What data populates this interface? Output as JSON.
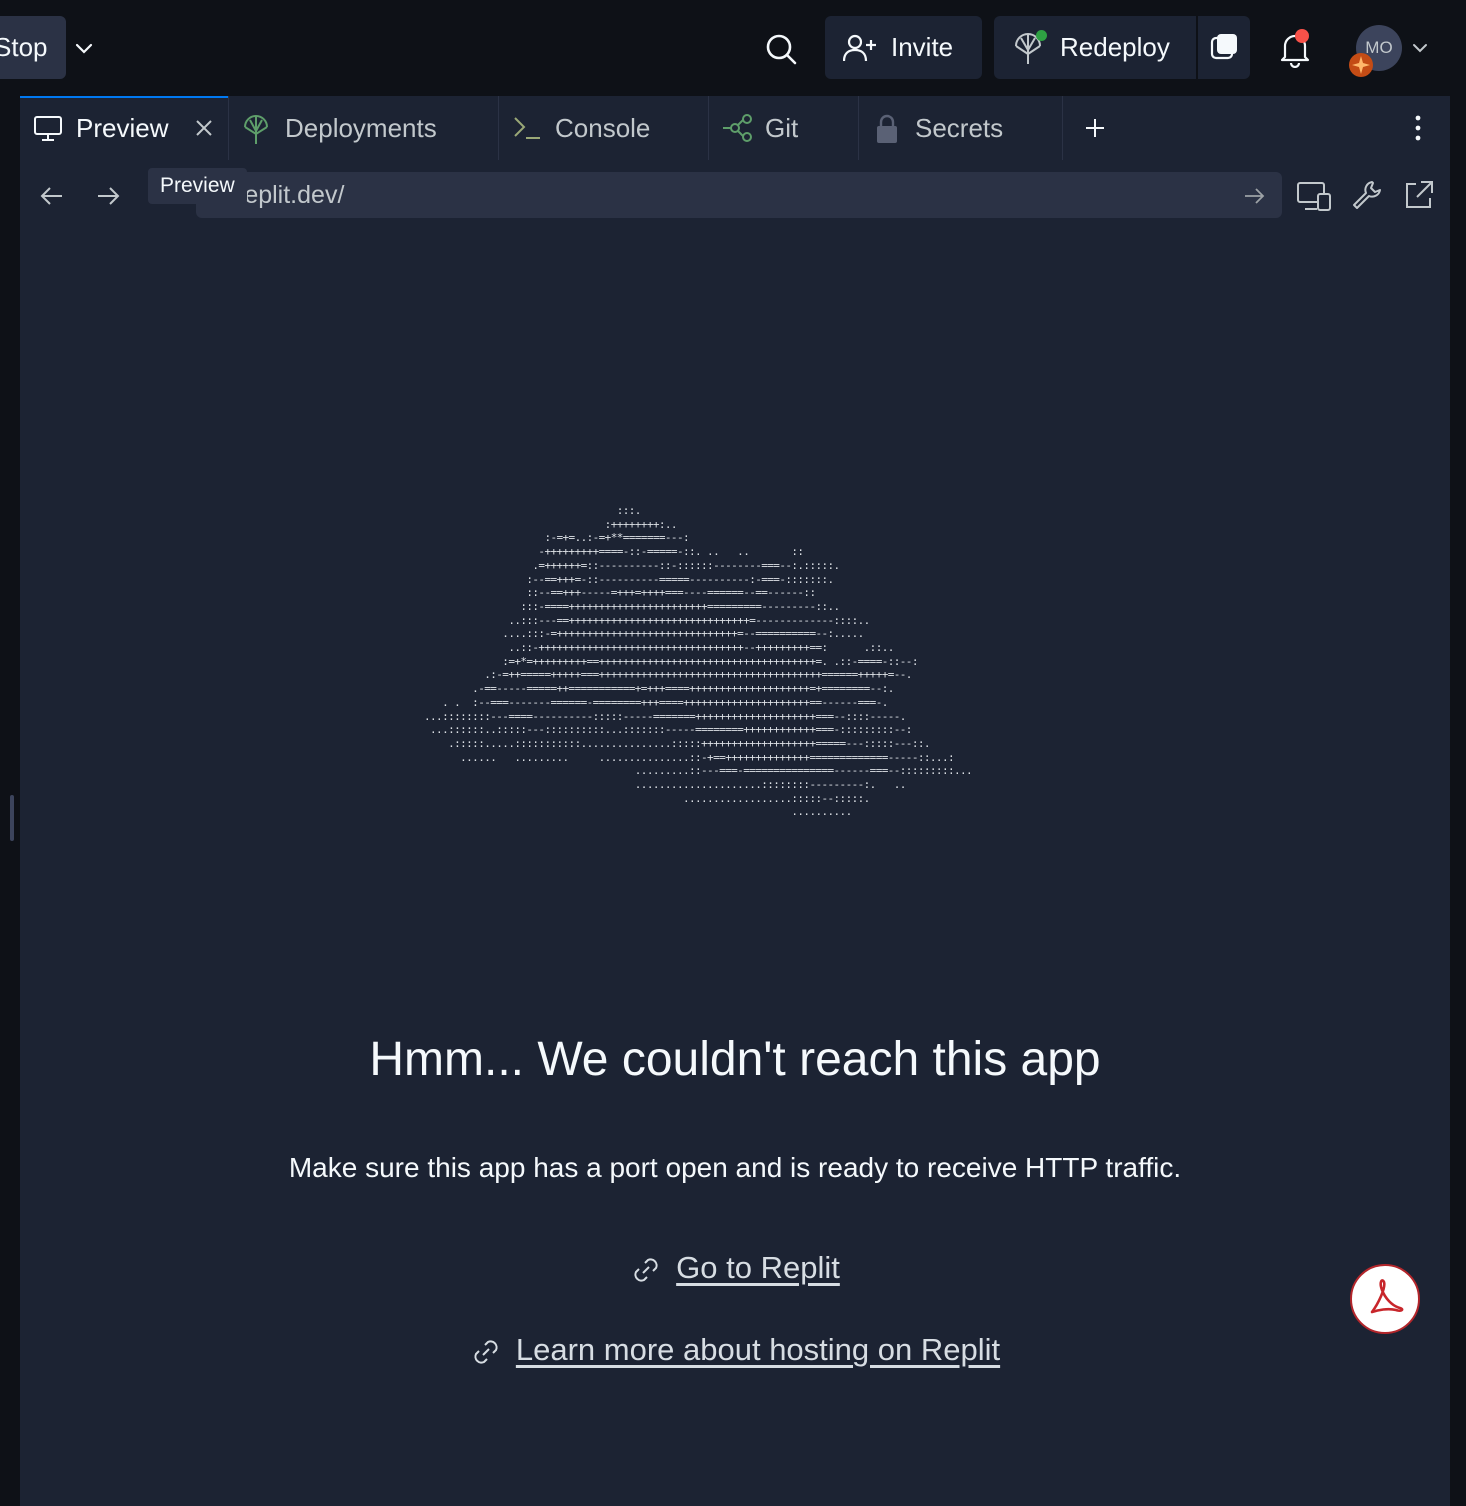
{
  "topbar": {
    "stop_label": "Stop",
    "invite_label": "Invite",
    "redeploy_label": "Redeploy",
    "avatar_initials": "MO",
    "notification_dot_color": "#f85149",
    "deploy_status_color": "#2ea043"
  },
  "tabs": [
    {
      "label": "Preview",
      "icon": "monitor-icon",
      "active": true
    },
    {
      "label": "Deployments",
      "icon": "deploy-icon"
    },
    {
      "label": "Console",
      "icon": "terminal-icon"
    },
    {
      "label": "Git",
      "icon": "git-icon"
    },
    {
      "label": "Secrets",
      "icon": "lock-icon"
    }
  ],
  "tooltip": "Preview",
  "urlbar": {
    "url": "replit.dev/"
  },
  "content": {
    "ascii_art": "                                :::.\n                              :++++++++:..\n                    :-=+=..:-=+**=======---:\n                   -+++++++++====-::-=====-::. ..   ..       ::\n                  .=++++++=::----------::-::::::--------===--:.:::::.\n                 :--==+++=-::----------=====----------:-===-:::::::.\n                 ::--==+++-----=+++=++++===----======--==------::\n                :::-====+++++++++++++++++++++++=========---------::..\n              ..:::---==++++++++++++++++++++++++++++++=-------------::::..\n             ....:::-=++++++++++++++++++++++++++++++=--==========--:.....\n              ..::-++++++++++++++++++++++++++++++++++--+++++++++==:      .::..\n             :=+*=+++++++++==++++++++++++++++++++++++++++++++++++=. .::-====-::--:\n          .:-=++=====+++++===+++++++++++++++++++++++++++++++++++++======+++++=--.\n        .-==-----=====++===========+=+++====++++++++++++++++++++=+========--:.\n   . .  :--===-------======-========+++====+++++++++++++++++++++==------===-.\n...::::::::---====----------:::::-----=======++++++++++++++++++++===--::::-----.\n ...::::::..:::::---::::::::::...:::::::-----========++++++++++++===-:::::::::--:\n    .:::::.....:::::::::::...............:::::+++++++++++++++++++=====---:::::---::.\n      ......   .........     ...............::-+==++++++++++++++=============-----::...:\n                                   .........::---===-===============------===--:::::::::...\n                                   .....................::::::::---------:.   ..\n                                           ..................:::::--:::::.\n                                                             ..........",
    "headline": "Hmm... We couldn't reach this app",
    "subtext": "Make sure this app has a port open and is ready to receive HTTP traffic.",
    "link_replit": "Go to Replit",
    "link_hosting": "Learn more about hosting on Replit"
  }
}
